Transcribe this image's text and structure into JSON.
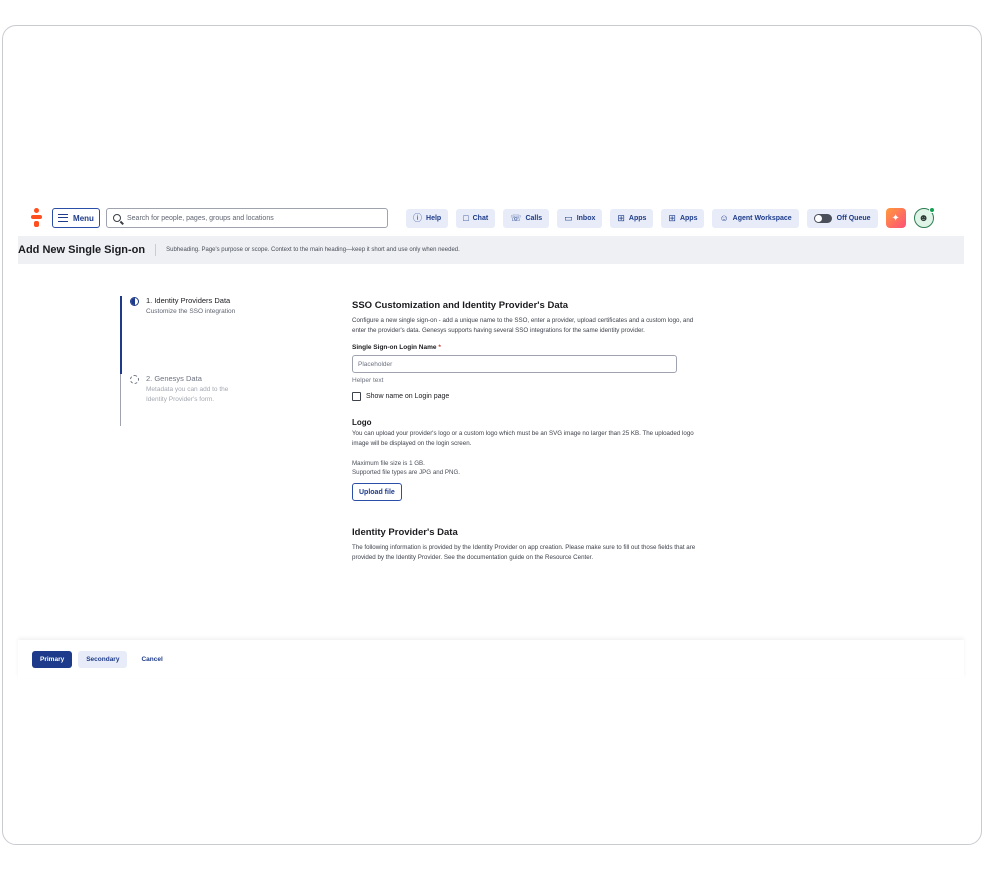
{
  "topbar": {
    "menu_label": "Menu",
    "search_placeholder": "Search for people, pages, groups and locations",
    "buttons": [
      {
        "label": "Help",
        "icon": "help-icon"
      },
      {
        "label": "Chat",
        "icon": "chat-icon"
      },
      {
        "label": "Calls",
        "icon": "phone-icon"
      },
      {
        "label": "Inbox",
        "icon": "inbox-icon"
      },
      {
        "label": "Apps",
        "icon": "apps-icon"
      },
      {
        "label": "Apps",
        "icon": "apps-icon"
      },
      {
        "label": "Agent Workspace",
        "icon": "agent-icon"
      }
    ],
    "queue_label": "Off Queue"
  },
  "header": {
    "title": "Add New Single Sign-on",
    "subheading": "Subheading. Page's purpose or scope. Context to the main heading—keep it short and use only when needed."
  },
  "stepper": {
    "steps": [
      {
        "title": "1. Identity Providers Data",
        "desc": "Customize the SSO integration"
      },
      {
        "title": "2. Genesys Data",
        "desc": "Metadata you can add to the Identity Provider's form."
      }
    ]
  },
  "form": {
    "section_title": "SSO Customization and Identity Provider's Data",
    "section_desc": "Configure a new single sign-on - add a unique name to the SSO, enter a provider, upload certificates and a custom logo, and enter the provider's data. Genesys supports having several SSO integrations for the same identity provider.",
    "login_name_label": "Single Sign-on Login Name",
    "required_mark": "*",
    "login_name_placeholder": "Placeholder",
    "helper_text": "Helper text",
    "show_name_label": "Show name on Login page",
    "logo_title": "Logo",
    "logo_desc": "You can upload your provider's logo or a custom logo which must be an SVG image no larger than 25 KB. The uploaded logo image will be displayed on the login screen.",
    "max_size": "Maximum file size is 1 GB.",
    "file_types": "Supported file types are JPG and PNG.",
    "upload_label": "Upload file",
    "idp_title": "Identity Provider's Data",
    "idp_desc": "The following information is provided by the Identity Provider on app creation. Please make sure to fill out those fields that are provided by the Identity Provider. See the documentation guide on the Resource Center."
  },
  "footer": {
    "primary": "Primary",
    "secondary": "Secondary",
    "cancel": "Cancel"
  }
}
